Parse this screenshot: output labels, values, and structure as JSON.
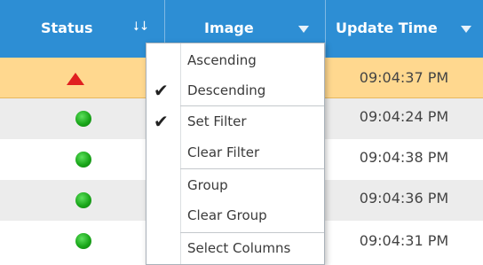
{
  "columns": {
    "status": {
      "label": "Status",
      "sort_icon": "sort-desc-icon",
      "sort_glyph": "⭣↓"
    },
    "image": {
      "label": "Image",
      "filter_icon": "filter-dropdown-icon"
    },
    "update_time": {
      "label": "Update Time",
      "filter_icon": "filter-dropdown-icon"
    }
  },
  "rows": [
    {
      "status": "warning",
      "status_icon": "red-triangle-icon",
      "time": "09:04:37 PM",
      "selected": true
    },
    {
      "status": "ok",
      "status_icon": "green-dot-icon",
      "time": "09:04:24 PM"
    },
    {
      "status": "ok",
      "status_icon": "green-dot-icon",
      "time": "09:04:38 PM"
    },
    {
      "status": "ok",
      "status_icon": "green-dot-icon",
      "time": "09:04:36 PM"
    },
    {
      "status": "ok",
      "status_icon": "green-dot-icon",
      "time": "09:04:31 PM"
    }
  ],
  "menu": {
    "items": [
      {
        "label": "Ascending",
        "checked": false
      },
      {
        "label": "Descending",
        "checked": true
      },
      {
        "label": "Set Filter",
        "checked": true
      },
      {
        "label": "Clear Filter",
        "checked": false
      },
      {
        "label": "Group",
        "checked": false
      },
      {
        "label": "Clear Group",
        "checked": false
      },
      {
        "label": "Select Columns",
        "checked": false
      }
    ],
    "check_glyph": "✔"
  },
  "colors": {
    "header": "#2d8ed4",
    "selected_row": "#ffd88f",
    "alt_row": "#ececec",
    "ok_status": "#1aa71a",
    "warning_status": "#e02020"
  }
}
